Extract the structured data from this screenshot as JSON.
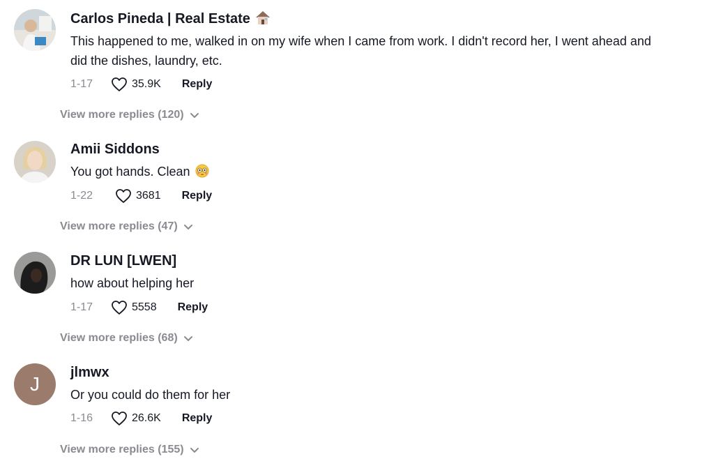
{
  "comments": [
    {
      "avatar": "photo-avatar-realtor",
      "username": "Carlos Pineda | Real Estate",
      "badge": "house-emoji-icon",
      "text": "This happened to me, walked in on my wife when I came from work. I didn't record her, I went ahead and did the dishes, laundry, etc.",
      "date": "1-17",
      "likes": "35.9K",
      "reply_label": "Reply",
      "more_replies": "View more replies (120)"
    },
    {
      "avatar": "photo-avatar-blonde-woman",
      "username": "Amii Siddons",
      "text": "You got hands. Clean",
      "emoji": "flushed-face-emoji-icon",
      "date": "1-22",
      "likes": "3681",
      "reply_label": "Reply",
      "more_replies": "View more replies (47)"
    },
    {
      "avatar": "photo-avatar-dark-portrait",
      "username": "DR LUN [LWEN]",
      "text": "how about helping her",
      "date": "1-17",
      "likes": "5558",
      "reply_label": "Reply",
      "more_replies": "View more replies (68)"
    },
    {
      "avatar_letter": "J",
      "avatar_color": "#9b7b6c",
      "username": "jlmwx",
      "text": "Or you could do them for her",
      "date": "1-16",
      "likes": "26.6K",
      "reply_label": "Reply",
      "more_replies": "View more replies (155)"
    }
  ]
}
